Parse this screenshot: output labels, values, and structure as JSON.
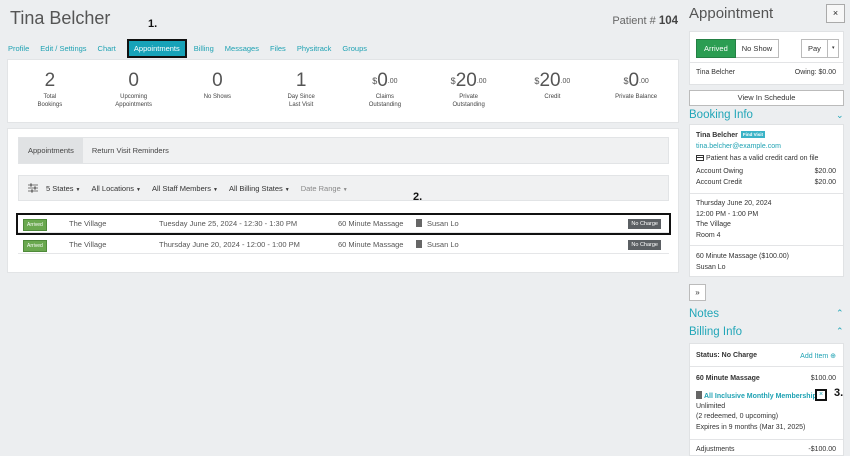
{
  "patient": {
    "name": "Tina Belcher",
    "number_label": "Patient #",
    "number": "104"
  },
  "callouts": {
    "one": "1.",
    "two": "2.",
    "three": "3."
  },
  "tabs": [
    {
      "label": "Profile"
    },
    {
      "label": "Edit / Settings"
    },
    {
      "label": "Chart"
    },
    {
      "label": "Appointments",
      "active": true
    },
    {
      "label": "Billing"
    },
    {
      "label": "Messages"
    },
    {
      "label": "Files"
    },
    {
      "label": "Physitrack"
    },
    {
      "label": "Groups"
    }
  ],
  "stats": [
    {
      "currency": "",
      "value": "2",
      "cents": "",
      "label_l1": "Total",
      "label_l2": "Bookings"
    },
    {
      "currency": "",
      "value": "0",
      "cents": "",
      "label_l1": "Upcoming",
      "label_l2": "Appointments"
    },
    {
      "currency": "",
      "value": "0",
      "cents": "",
      "label_l1": "No Shows",
      "label_l2": ""
    },
    {
      "currency": "",
      "value": "1",
      "cents": "",
      "label_l1": "Day Since",
      "label_l2": "Last Visit"
    },
    {
      "currency": "$",
      "value": "0",
      "cents": ".00",
      "label_l1": "Claims",
      "label_l2": "Outstanding"
    },
    {
      "currency": "$",
      "value": "20",
      "cents": ".00",
      "label_l1": "Private",
      "label_l2": "Outstanding"
    },
    {
      "currency": "$",
      "value": "20",
      "cents": ".00",
      "label_l1": "Credit",
      "label_l2": ""
    },
    {
      "currency": "$",
      "value": "0",
      "cents": ".00",
      "label_l1": "Private Balance",
      "label_l2": ""
    }
  ],
  "subtabs": [
    {
      "label": "Appointments",
      "active": true
    },
    {
      "label": "Return Visit Reminders"
    }
  ],
  "filters": {
    "states": "5 States",
    "locations": "All Locations",
    "staff": "All Staff Members",
    "billing": "All Billing States",
    "date_range": "Date Range"
  },
  "appointments": [
    {
      "status": "Arrived",
      "location": "The Village",
      "datetime": "Tuesday June 25, 2024 - 12:30 - 1:30 PM",
      "service": "60 Minute Massage",
      "staff": "Susan Lo",
      "billing": "No Charge"
    },
    {
      "status": "Arrived",
      "location": "The Village",
      "datetime": "Thursday June 20, 2024 - 12:00 - 1:00 PM",
      "service": "60 Minute Massage",
      "staff": "Susan Lo",
      "billing": "No Charge"
    }
  ],
  "sidebar": {
    "title": "Appointment",
    "close": "×",
    "arrived_btn": "Arrived",
    "noshow_btn": "No Show",
    "pay_btn": "Pay",
    "pay_caret": "▾",
    "patient_name": "Tina Belcher",
    "owing": "Owing: $0.00",
    "view_schedule": "View In Schedule",
    "booking_title": "Booking Info",
    "booking_name": "Tina Belcher",
    "find_visit": "Find Visit",
    "email": "tina.belcher@example.com",
    "credit_card_note": "Patient has a valid credit card on file",
    "account_owing_label": "Account Owing",
    "account_owing": "$20.00",
    "account_credit_label": "Account Credit",
    "account_credit": "$20.00",
    "appt_date": "Thursday June 20, 2024",
    "appt_time": "12:00 PM - 1:00 PM",
    "appt_location": "The Village",
    "appt_room": "Room 4",
    "appt_service": "60 Minute Massage ($100.00)",
    "appt_staff": "Susan Lo",
    "expand": "»",
    "notes_title": "Notes",
    "billing_title": "Billing Info",
    "status_label": "Status: No Charge",
    "add_item": "Add Item",
    "item_name": "60 Minute Massage",
    "item_price": "$100.00",
    "membership": "All Inclusive Monthly Membership",
    "membership_remove": "×",
    "unlimited": "Unlimited",
    "redeemed": "(2 redeemed, 0 upcoming)",
    "expires": "Expires in 9 months (Mar 31, 2025)",
    "adjustments_label": "Adjustments",
    "adjustments": "-$100.00"
  },
  "colors": {
    "accent": "#17a2b8",
    "arrived_green": "#2b9d52",
    "badge_green": "#6aa84f",
    "no_charge_grey": "#5b5f63"
  }
}
